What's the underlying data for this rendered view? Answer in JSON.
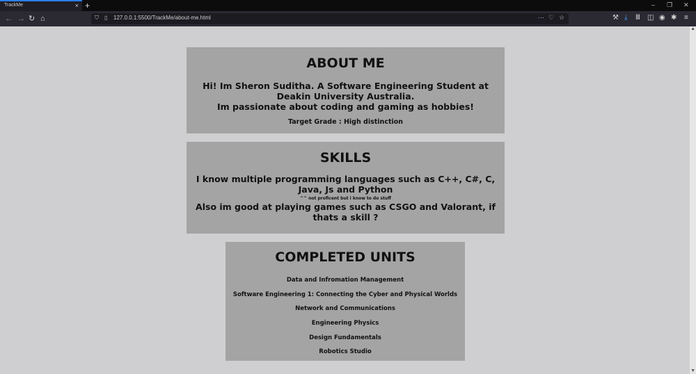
{
  "browser": {
    "tab_title": "TrackMe",
    "tab_close": "×",
    "new_tab": "+",
    "url": "127.0.0.1:5500/TrackMe/about-me.html",
    "url_more": "···",
    "win_min": "–",
    "win_max": "❐",
    "win_close": "✕",
    "nav_back": "←",
    "nav_forward": "→",
    "nav_reload": "↻",
    "nav_home": "⌂",
    "accent_color": "#2a7ee8"
  },
  "about": {
    "title": "ABOUT ME",
    "line1": "Hi! Im Sheron Suditha. A Software Engineering Student at",
    "line2": "Deakin University Australia.",
    "line3": "Im passionate about coding and gaming as hobbies!",
    "grade": "Target Grade : High distinction"
  },
  "skills": {
    "title": "SKILLS",
    "line1": "I know multiple programming languages such as C++, C#, C,",
    "line2": "Java, Js and Python",
    "note": "^^ not proficent but i know to do stuff",
    "line3": "Also im good at playing games such as CSGO and Valorant, if",
    "line4": "thats a skill ?"
  },
  "units": {
    "title": "COMPLETED UNITS",
    "items": [
      "Data and Infromation Management",
      "Software Engineering 1: Connecting the Cyber and Physical Worlds",
      "Network and Communications",
      "Engineering Physics",
      "Design Fundamentals",
      "Robotics Studio"
    ]
  }
}
